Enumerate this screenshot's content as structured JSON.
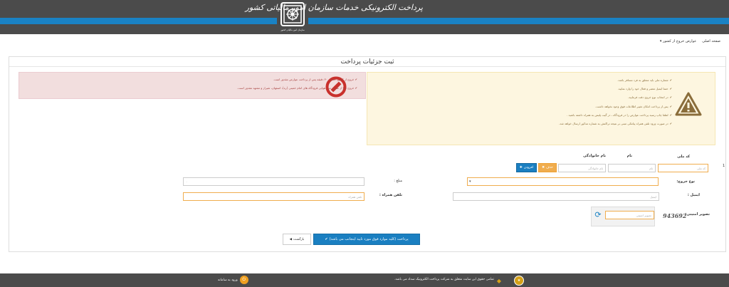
{
  "header": {
    "title": "پرداخت الکترونیکی خدمات سازمان امور مالیاتی کشور",
    "logo_caption": "سازمان امور مالیاتی کشور"
  },
  "breadcrumb": {
    "home": "صفحه اصلی",
    "current": "عوارض خروج از کشور"
  },
  "panel": {
    "title": "ثبت جزئیات پرداخت"
  },
  "info": {
    "items": [
      "شماره ملی باید متعلق به فرد مسافر باشد.",
      "حتما ایمیل معتبر و فعال خود را وارد نمایید.",
      "در انتخاب نوع خروج دقت فرمایید.",
      "پس از پرداخت امکان تغییر اطلاعات فوق وجود نخواهد داشت.",
      "لطفا چاپ رسید پرداخت عوارض را در فرودگاه ، در گیت پلیس به همراه داشته باشید .",
      "در صورت ورود تلفن همراه پیامکی مبنی بر نتیجه تراکنش به شماره مذکور ارسال خواهد شد."
    ]
  },
  "danger": {
    "items": [
      "خروج از کشور حداقل ۳۰ دقیقه پس از پرداخت عوارض مقدور است.",
      "خروج تنها از طریق مرز هوایی فرودگاه های امام خمینی (ره)، اصفهان، شیراز و مشهد مقدور است."
    ]
  },
  "form": {
    "row_number": "1",
    "national_code_label": "کد ملی",
    "national_code_placeholder": "کد ملی",
    "first_name_label": "نام",
    "first_name_placeholder": "نام",
    "last_name_label": "نام خانوادگی",
    "last_name_placeholder": "نام خانوادگی",
    "clear_label": "حذف",
    "add_label": "افزودن",
    "exit_type_label": "نوع خروج:",
    "amount_label": "مبلغ :",
    "amount_value": "۰",
    "email_label": "ایمیل :",
    "email_placeholder": "ایمیل",
    "mobile_label": "تلفن همراه :",
    "mobile_placeholder": "تلفن همراه",
    "captcha_label": "تصویر امنیتی:",
    "captcha_placeholder": "تصویر امنیتی",
    "captcha_text": "943692",
    "pay_label": "پرداخت (کلیه موارد فوق مورد تایید اینجانب می باشد)",
    "back_label": "بازگشت"
  },
  "footer": {
    "copyright": "تمامی حقوق این سایت متعلق به شرکت پرداخت الکترونیک سداد می باشد.",
    "login_label": "ورود به سامانه"
  },
  "colors": {
    "header_bg": "#4b4b4b",
    "accent_blue": "#1a82c4",
    "warning": "#f0ad4e",
    "danger": "#a94442"
  }
}
